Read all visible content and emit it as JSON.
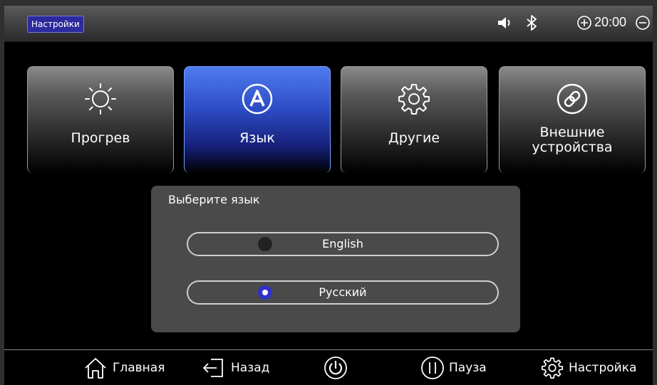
{
  "statusbar": {
    "title": "Настройки",
    "time": "20:00",
    "icons": [
      "speaker-icon",
      "bluetooth-icon",
      "zoom-in-icon",
      "zoom-out-icon"
    ]
  },
  "tabs": [
    {
      "label": "Прогрев",
      "icon": "sun-icon",
      "active": false
    },
    {
      "label": "Язык",
      "icon": "letter-a-icon",
      "active": true
    },
    {
      "label": "Другие",
      "icon": "gear-icon",
      "active": false
    },
    {
      "label": "Внешние\nустройства",
      "icon": "link-icon",
      "active": false
    }
  ],
  "language_panel": {
    "title": "Выберите язык",
    "options": [
      {
        "label": "English",
        "selected": false
      },
      {
        "label": "Русский",
        "selected": true
      }
    ]
  },
  "bottom_nav": {
    "home": "Главная",
    "back": "Назад",
    "power": "",
    "pause": "Пауза",
    "settings": "Настройка"
  },
  "colors": {
    "accent": "#2d4cc4",
    "badge": "#2c2a9c",
    "panel": "#4a4a4a"
  }
}
